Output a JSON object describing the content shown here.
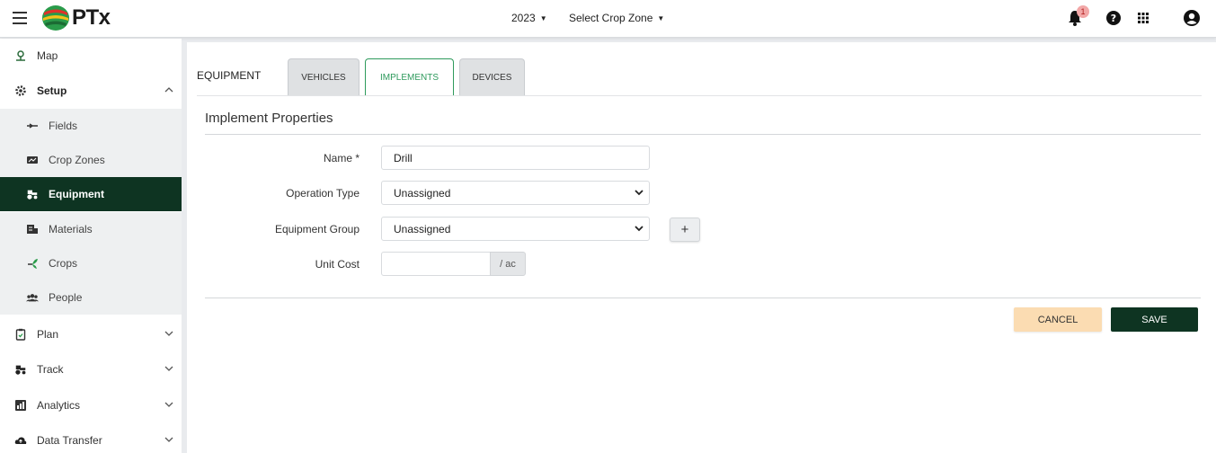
{
  "header": {
    "logo_text": "PTx",
    "year": "2023",
    "crop_zone": "Select Crop Zone",
    "notification_count": "1",
    "icons": [
      "menu-icon",
      "bell-icon",
      "help-icon",
      "apps-grid-icon",
      "account-icon"
    ]
  },
  "sidebar": {
    "items": [
      {
        "label": "Map",
        "icon": "map-pin-icon"
      },
      {
        "label": "Setup",
        "icon": "gear-icon",
        "expanded": true
      },
      {
        "label": "Fields",
        "icon": "field-icon"
      },
      {
        "label": "Crop Zones",
        "icon": "crop-zones-icon"
      },
      {
        "label": "Equipment",
        "icon": "tractor-icon",
        "active": true
      },
      {
        "label": "Materials",
        "icon": "materials-icon"
      },
      {
        "label": "Crops",
        "icon": "crops-icon"
      },
      {
        "label": "People",
        "icon": "people-icon"
      },
      {
        "label": "Plan",
        "icon": "clipboard-icon"
      },
      {
        "label": "Track",
        "icon": "tractor-icon"
      },
      {
        "label": "Analytics",
        "icon": "analytics-icon"
      },
      {
        "label": "Data Transfer",
        "icon": "cloud-icon"
      }
    ]
  },
  "main": {
    "section_label": "EQUIPMENT",
    "tabs": [
      {
        "label": "VEHICLES",
        "active": false
      },
      {
        "label": "IMPLEMENTS",
        "active": true
      },
      {
        "label": "DEVICES",
        "active": false
      }
    ],
    "heading": "Implement Properties",
    "form": {
      "name_label": "Name *",
      "name_value": "Drill",
      "operation_type_label": "Operation Type",
      "operation_type_value": "Unassigned",
      "equipment_group_label": "Equipment Group",
      "equipment_group_value": "Unassigned",
      "add_group_label": "+",
      "unit_cost_label": "Unit Cost",
      "unit_cost_value": "",
      "unit_cost_unit": "/ ac"
    },
    "actions": {
      "cancel_label": "CANCEL",
      "save_label": "SAVE"
    }
  },
  "colors": {
    "brand_dark_green": "#0e3422",
    "accent_green": "#2e9a5c",
    "cancel_bg": "#fbdcb2"
  }
}
